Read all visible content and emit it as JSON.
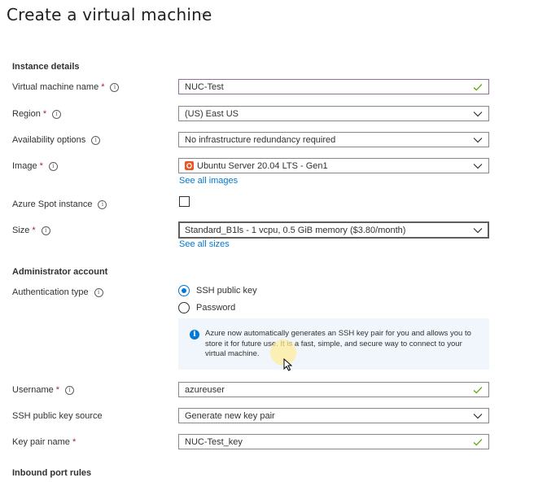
{
  "header": {
    "title": "Create a virtual machine",
    "more_label": "···"
  },
  "sections": {
    "instance_details": "Instance details",
    "administrator_account": "Administrator account",
    "inbound_port_rules": "Inbound port rules"
  },
  "fields": {
    "vm_name": {
      "label": "Virtual machine name",
      "required": "*",
      "value": "NUC-Test"
    },
    "region": {
      "label": "Region",
      "required": "*",
      "value": "(US) East US"
    },
    "availability": {
      "label": "Availability options",
      "value": "No infrastructure redundancy required"
    },
    "image": {
      "label": "Image",
      "required": "*",
      "value": "Ubuntu Server 20.04 LTS - Gen1",
      "link": "See all images"
    },
    "spot": {
      "label": "Azure Spot instance",
      "checked": false
    },
    "size": {
      "label": "Size",
      "required": "*",
      "value": "Standard_B1ls - 1 vcpu, 0.5 GiB memory ($3.80/month)",
      "link": "See all sizes"
    },
    "auth_type": {
      "label": "Authentication type",
      "options": [
        "SSH public key",
        "Password"
      ],
      "selected": "SSH public key"
    },
    "username": {
      "label": "Username",
      "required": "*",
      "value": "azureuser"
    },
    "ssh_source": {
      "label": "SSH public key source",
      "value": "Generate new key pair"
    },
    "key_pair_name": {
      "label": "Key pair name",
      "required": "*",
      "value": "NUC-Test_key"
    }
  },
  "info_message": "Azure now automatically generates an SSH key pair for you and allows you to store it for future use. It is a fast, simple, and secure way to connect to your virtual machine.",
  "colors": {
    "link": "#0078d4",
    "valid_check": "#57a300",
    "required": "#a4262c",
    "info_bg": "#f0f6fc",
    "ubuntu": "#e95420"
  },
  "icons": {
    "info": "i",
    "check": "check-icon",
    "chevron": "chevron-down-icon"
  }
}
